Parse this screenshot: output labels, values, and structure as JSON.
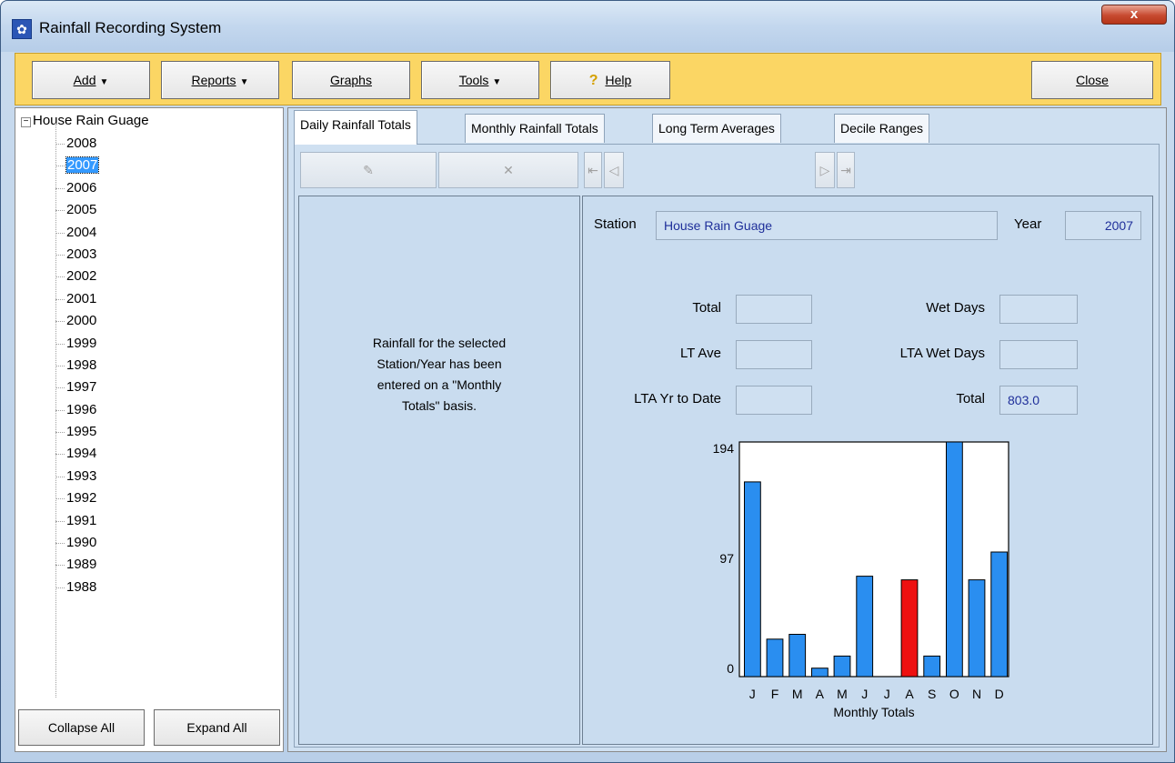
{
  "window": {
    "title": "Rainfall Recording System",
    "close_glyph": "x"
  },
  "toolbar": {
    "add": "Add",
    "reports": "Reports",
    "graphs": "Graphs",
    "tools": "Tools",
    "help": "Help",
    "close": "Close"
  },
  "tree": {
    "root": "House Rain Guage",
    "years": [
      "2008",
      "2007",
      "2006",
      "2005",
      "2004",
      "2003",
      "2002",
      "2001",
      "2000",
      "1999",
      "1998",
      "1997",
      "1996",
      "1995",
      "1994",
      "1993",
      "1992",
      "1991",
      "1990",
      "1989",
      "1988"
    ],
    "selected": "2007"
  },
  "tree_buttons": {
    "collapse": "Collapse All",
    "expand": "Expand All"
  },
  "tabs": [
    "Daily Rainfall Totals",
    "Monthly Rainfall Totals",
    "Long Term Averages",
    "Decile Ranges"
  ],
  "message": [
    "Rainfall for the selected",
    "Station/Year has been",
    "entered on a \"Monthly",
    "Totals\" basis."
  ],
  "form": {
    "station_label": "Station",
    "station_value": "House Rain Guage",
    "year_label": "Year",
    "year_value": "2007",
    "total_label": "Total",
    "total_value": "",
    "lt_ave_label": "LT Ave",
    "lt_ave_value": "",
    "lta_ytd_label": "LTA Yr to Date",
    "lta_ytd_value": "",
    "wet_days_label": "Wet Days",
    "wet_days_value": "",
    "lta_wet_days_label": "LTA Wet Days",
    "lta_wet_days_value": "",
    "total2_label": "Total",
    "total2_value": "803.0"
  },
  "chart_data": {
    "type": "bar",
    "categories": [
      "J",
      "F",
      "M",
      "A",
      "M",
      "J",
      "J",
      "A",
      "S",
      "O",
      "N",
      "D"
    ],
    "values": [
      161,
      31,
      35,
      7,
      17,
      83,
      0,
      80,
      17,
      194,
      80,
      103
    ],
    "highlight_index": 7,
    "colors": {
      "bar": "#2a8ef0",
      "highlight": "#ee1111"
    },
    "xlabel": "Monthly Totals",
    "ylim": [
      0,
      194
    ],
    "yticks": [
      0,
      97,
      194
    ]
  }
}
